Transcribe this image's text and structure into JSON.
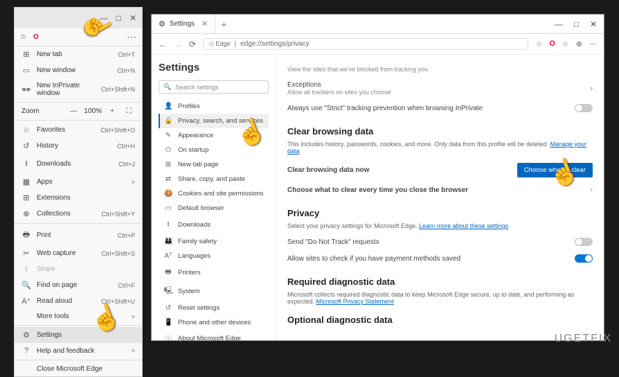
{
  "watermark": "UGETFIX",
  "dropdown": {
    "titlebar_min": "—",
    "titlebar_max": "□",
    "titlebar_close": "✕",
    "toprow_dots": "⋯",
    "items_top": [
      {
        "icon": "⊞",
        "label": "New tab",
        "shortcut": "Ctrl+T"
      },
      {
        "icon": "▭",
        "label": "New window",
        "shortcut": "Ctrl+N"
      },
      {
        "icon": "🕶",
        "label": "New InPrivate window",
        "shortcut": "Ctrl+Shift+N"
      }
    ],
    "zoom": {
      "label": "Zoom",
      "value": "100%",
      "minus": "—",
      "plus": "+",
      "expand": "⛶"
    },
    "items_mid": [
      {
        "icon": "☆",
        "label": "Favorites",
        "shortcut": "Ctrl+Shift+O"
      },
      {
        "icon": "↺",
        "label": "History",
        "shortcut": "Ctrl+H"
      },
      {
        "icon": "⭳",
        "label": "Downloads",
        "shortcut": "Ctrl+J"
      },
      {
        "icon": "▦",
        "label": "Apps",
        "shortcut": "",
        "chev": ">"
      },
      {
        "icon": "⊞",
        "label": "Extensions",
        "shortcut": ""
      },
      {
        "icon": "⊕",
        "label": "Collections",
        "shortcut": "Ctrl+Shift+Y"
      }
    ],
    "items_print": [
      {
        "icon": "🖶",
        "label": "Print",
        "shortcut": "Ctrl+P"
      },
      {
        "icon": "✂",
        "label": "Web capture",
        "shortcut": "Ctrl+Shift+S"
      },
      {
        "icon": "⇪",
        "label": "Share",
        "shortcut": "",
        "disabled": true
      },
      {
        "icon": "🔍",
        "label": "Find on page",
        "shortcut": "Ctrl+F"
      },
      {
        "icon": "A⁺",
        "label": "Read aloud",
        "shortcut": "Ctrl+Shift+U"
      },
      {
        "icon": "",
        "label": "More tools",
        "shortcut": "",
        "chev": ">"
      }
    ],
    "items_bottom": [
      {
        "icon": "⚙",
        "label": "Settings",
        "shortcut": "",
        "hl": true
      },
      {
        "icon": "?",
        "label": "Help and feedback",
        "shortcut": "",
        "chev": ">"
      }
    ],
    "close_label": "Close Microsoft Edge"
  },
  "window": {
    "tab_title": "Settings",
    "titlebar_min": "—",
    "titlebar_max": "□",
    "titlebar_close": "✕",
    "addr": {
      "back": "←",
      "fwd": "→",
      "reload": "⟳",
      "badge": "◇ Edge",
      "url": "edge://settings/privacy",
      "star": "☆",
      "opera": "O",
      "fav": "☆",
      "col": "⊕",
      "dots": "⋯"
    },
    "sidebar": {
      "title": "Settings",
      "search_placeholder": "Search settings",
      "items": [
        {
          "icon": "👤",
          "label": "Profiles"
        },
        {
          "icon": "🔒",
          "label": "Privacy, search, and services",
          "active": true
        },
        {
          "icon": "✎",
          "label": "Appearance"
        },
        {
          "icon": "⏻",
          "label": "On startup"
        },
        {
          "icon": "⊞",
          "label": "New tab page"
        },
        {
          "icon": "⇄",
          "label": "Share, copy, and paste"
        },
        {
          "icon": "🍪",
          "label": "Cookies and site permissions"
        },
        {
          "icon": "▭",
          "label": "Default browser"
        },
        {
          "icon": "⭳",
          "label": "Downloads"
        },
        {
          "icon": "👪",
          "label": "Family safety"
        },
        {
          "icon": "Aᵀ",
          "label": "Languages"
        },
        {
          "icon": "🖶",
          "label": "Printers"
        },
        {
          "icon": "🖳",
          "label": "System"
        },
        {
          "icon": "↺",
          "label": "Reset settings"
        },
        {
          "icon": "📱",
          "label": "Phone and other devices"
        },
        {
          "icon": "ⓘ",
          "label": "About Microsoft Edge"
        }
      ]
    },
    "main": {
      "tracking_sub": "View the sites that we've blocked from tracking you",
      "exceptions": "Exceptions",
      "exceptions_sub": "Allow all trackers on sites you choose",
      "strict": "Always use \"Strict\" tracking prevention when browsing InPrivate",
      "h_clear": "Clear browsing data",
      "clear_desc": "This includes history, passwords, cookies, and more. Only data from this profile will be deleted.",
      "manage_link": "Manage your data",
      "clear_now": "Clear browsing data now",
      "choose_btn": "Choose what to clear",
      "clear_every": "Choose what to clear every time you close the browser",
      "h_privacy": "Privacy",
      "privacy_desc": "Select your privacy settings for Microsoft Edge.",
      "privacy_link": "Learn more about these settings",
      "dnt": "Send \"Do Not Track\" requests",
      "payment": "Allow sites to check if you have payment methods saved",
      "h_diag": "Required diagnostic data",
      "diag_desc": "Microsoft collects required diagnostic data to keep Microsoft Edge secure, up to date, and performing as expected.",
      "diag_link": "Microsoft Privacy Statement",
      "h_opt": "Optional diagnostic data"
    }
  }
}
